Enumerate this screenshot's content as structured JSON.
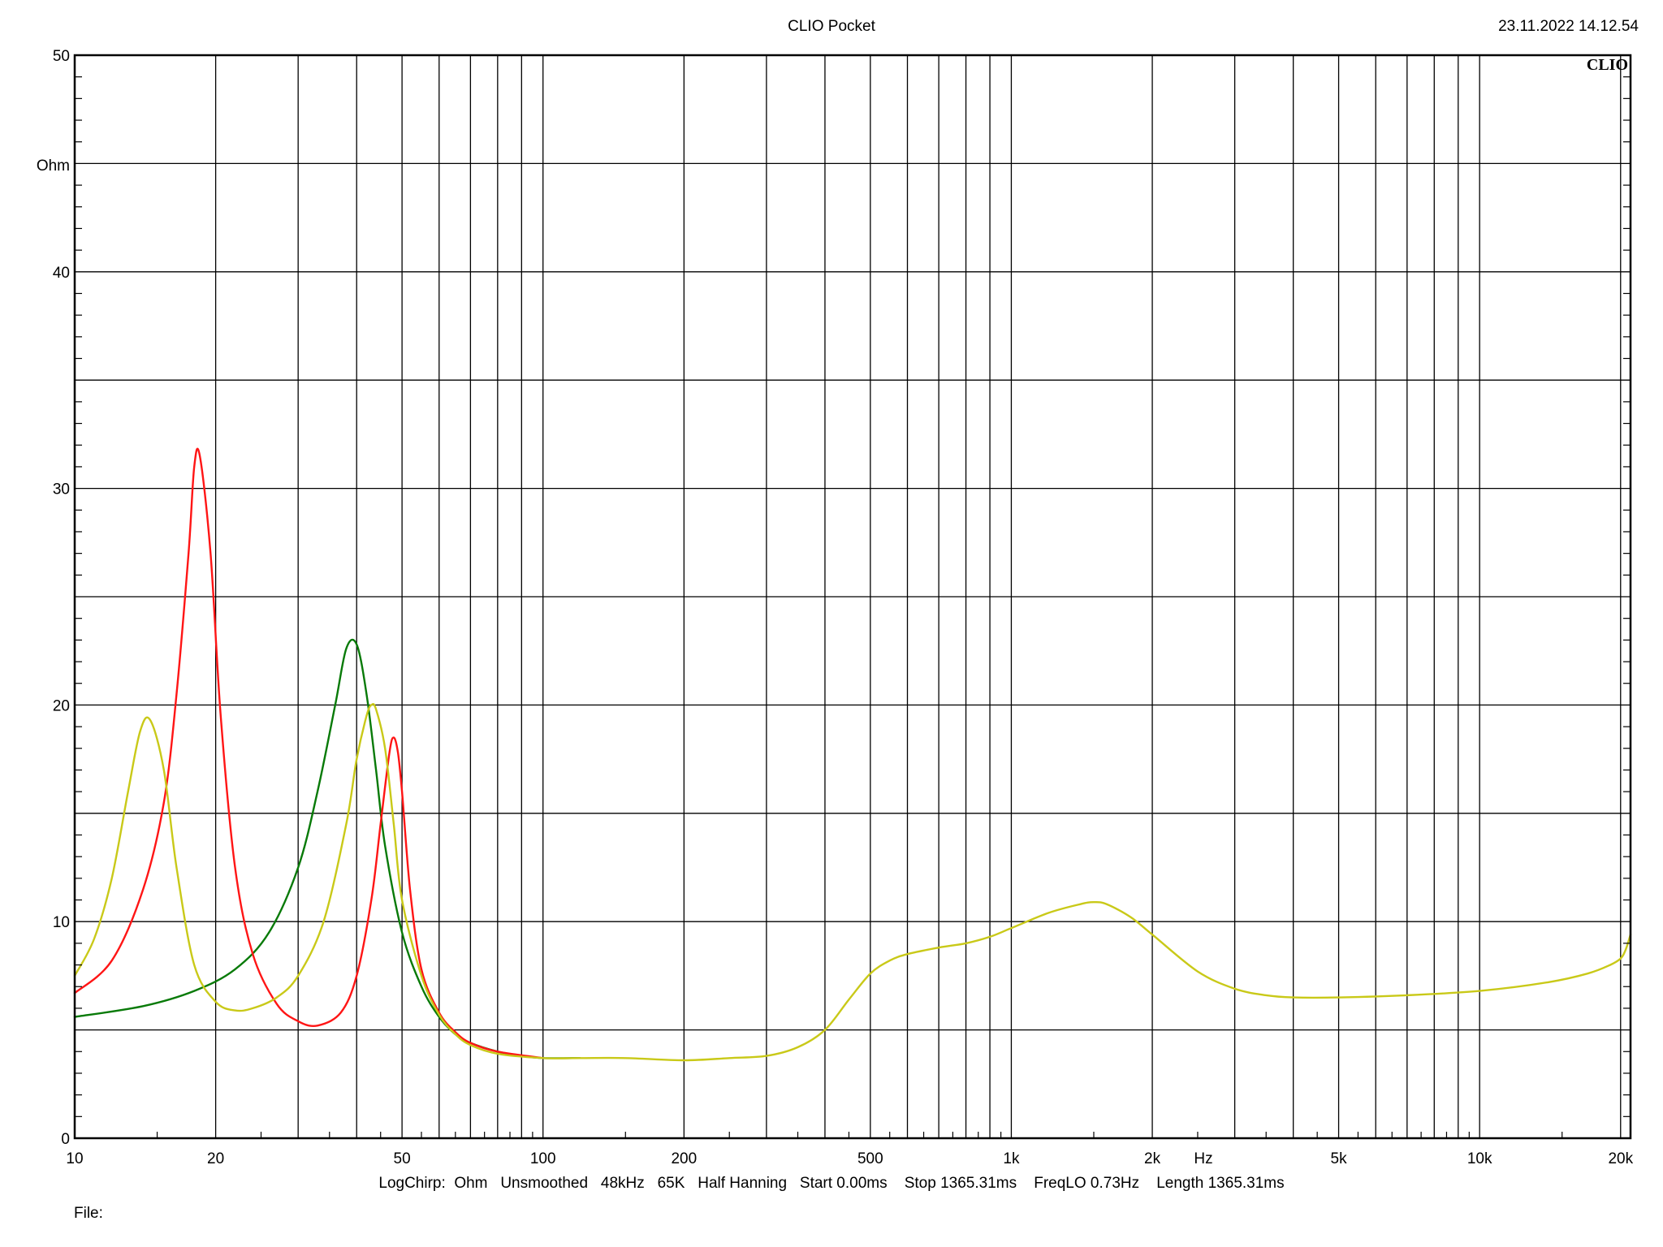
{
  "header": {
    "title": "CLIO Pocket",
    "datetime": "23.11.2022 14.12.54",
    "logo": "CLIO"
  },
  "footer": {
    "info": "LogChirp:  Ohm   Unsmoothed   48kHz   65K   Half Hanning   Start 0.00ms    Stop 1365.31ms    FreqLO 0.73Hz    Length 1365.31ms",
    "file_label": "File:"
  },
  "chart_data": {
    "type": "line",
    "title": "",
    "xscale": "log",
    "xlim": [
      10,
      21000
    ],
    "ylim": [
      0,
      50
    ],
    "xunit": "Hz",
    "yunit": "Ohm",
    "grid": true,
    "x_ticks": [
      {
        "value": 10,
        "label": "10"
      },
      {
        "value": 20,
        "label": "20"
      },
      {
        "value": 50,
        "label": "50"
      },
      {
        "value": 100,
        "label": "100"
      },
      {
        "value": 200,
        "label": "200"
      },
      {
        "value": 500,
        "label": "500"
      },
      {
        "value": 1000,
        "label": "1k"
      },
      {
        "value": 2000,
        "label": "2k"
      },
      {
        "value": 5000,
        "label": "5k"
      },
      {
        "value": 10000,
        "label": "10k"
      },
      {
        "value": 20000,
        "label": "20k"
      }
    ],
    "y_ticks": [
      {
        "value": 0,
        "label": "0"
      },
      {
        "value": 10,
        "label": "10"
      },
      {
        "value": 20,
        "label": "20"
      },
      {
        "value": 30,
        "label": "30"
      },
      {
        "value": 40,
        "label": "40"
      },
      {
        "value": 50,
        "label": "50"
      }
    ],
    "colors": {
      "green": "#087a08",
      "red": "#ff1515",
      "yellow": "#c9c918"
    },
    "series": [
      {
        "color": "green",
        "x": [
          10,
          14,
          18,
          22,
          26,
          30,
          33,
          36,
          38,
          40,
          42,
          44,
          46,
          50,
          55,
          60,
          65,
          70,
          80,
          90,
          100,
          120
        ],
        "y": [
          5.6,
          6.1,
          6.8,
          7.8,
          9.5,
          12.5,
          16.0,
          20.0,
          22.6,
          22.8,
          20.5,
          17.0,
          13.5,
          9.5,
          7.0,
          5.6,
          4.8,
          4.4,
          4.0,
          3.8,
          3.7,
          3.7
        ]
      },
      {
        "color": "red",
        "x": [
          10,
          12,
          14,
          15.5,
          16.5,
          17.5,
          18,
          18.5,
          19.5,
          20.5,
          22,
          24,
          27,
          30,
          33,
          37,
          40,
          43,
          45,
          47,
          48,
          49,
          50,
          52,
          55,
          60,
          65,
          70,
          80,
          100
        ],
        "y": [
          6.7,
          8.2,
          11.5,
          15.5,
          20.5,
          27.0,
          31.0,
          31.5,
          27.0,
          19.5,
          12.5,
          8.5,
          6.2,
          5.4,
          5.2,
          5.8,
          7.5,
          11.0,
          14.5,
          17.8,
          18.5,
          17.8,
          16.0,
          11.5,
          7.8,
          5.8,
          4.9,
          4.4,
          4.0,
          3.7
        ]
      },
      {
        "color": "yellow",
        "x": [
          10,
          11,
          12,
          13,
          13.8,
          14.5,
          15.5,
          16.5,
          18,
          20,
          22,
          24,
          27,
          30,
          34,
          38,
          40,
          42,
          43,
          44,
          46,
          48,
          50,
          55,
          60,
          65,
          70,
          80,
          100,
          120,
          150,
          200,
          250,
          300,
          350,
          400,
          450,
          500,
          550,
          600,
          700,
          800,
          900,
          1000,
          1200,
          1400,
          1500,
          1600,
          1800,
          2000,
          2500,
          3000,
          3500,
          4000,
          5000,
          7000,
          10000,
          14000,
          17000,
          19000,
          20000,
          20500,
          21000
        ],
        "y": [
          7.5,
          9.2,
          12.0,
          16.0,
          18.8,
          19.3,
          17.0,
          12.5,
          8.0,
          6.3,
          5.9,
          6.0,
          6.5,
          7.5,
          10.0,
          14.5,
          17.5,
          19.5,
          20.0,
          19.8,
          18.0,
          14.5,
          11.0,
          7.5,
          5.7,
          4.8,
          4.3,
          3.9,
          3.7,
          3.7,
          3.7,
          3.6,
          3.7,
          3.8,
          4.2,
          5.0,
          6.4,
          7.6,
          8.2,
          8.5,
          8.8,
          9.0,
          9.3,
          9.7,
          10.4,
          10.8,
          10.9,
          10.8,
          10.2,
          9.4,
          7.7,
          6.9,
          6.6,
          6.5,
          6.5,
          6.6,
          6.8,
          7.2,
          7.6,
          8.0,
          8.3,
          8.7,
          9.4
        ]
      }
    ]
  }
}
